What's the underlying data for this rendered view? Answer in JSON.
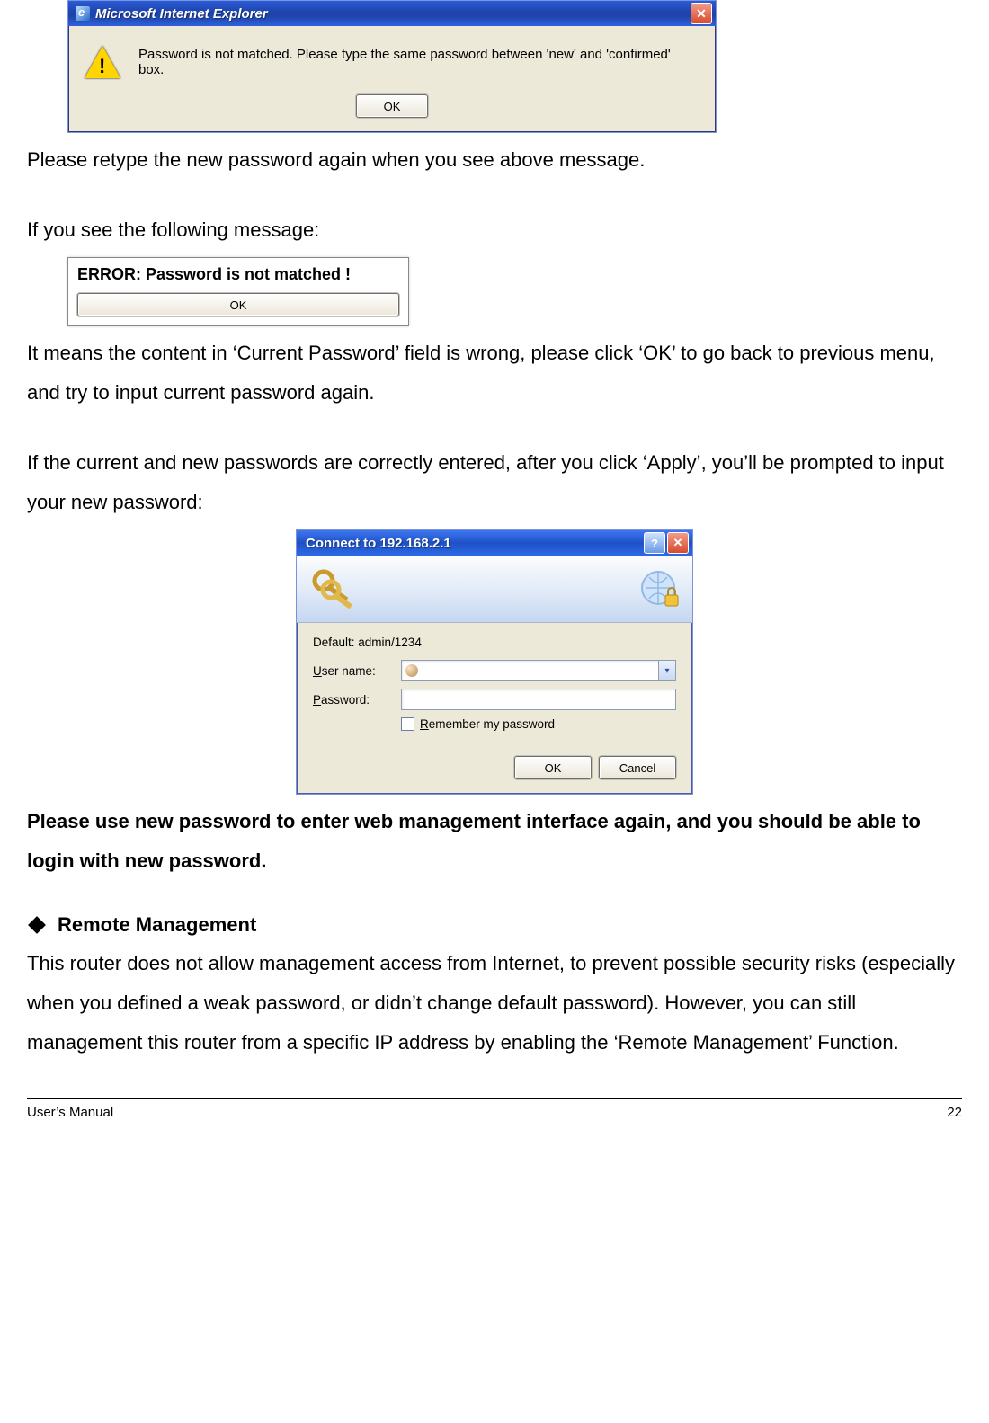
{
  "dialog1": {
    "title": "Microsoft Internet Explorer",
    "message": "Password is not matched. Please type the same password between 'new' and 'confirmed' box.",
    "ok": "OK"
  },
  "para1": "Please retype the new password again when you see above message.",
  "para2": "If you see the following message:",
  "dialog2": {
    "title": "ERROR: Password is not matched !",
    "ok": "OK"
  },
  "para3": "It means the content in ‘Current Password’ field is wrong, please click ‘OK’ to go back to previous menu, and try to input current password again.",
  "para4": "If the current and new passwords are correctly entered, after you click ‘Apply’, you’ll be prompted to input your new password:",
  "dialog3": {
    "title": "Connect to 192.168.2.1",
    "default": "Default: admin/1234",
    "user_label": "User name:",
    "pass_label": "Password:",
    "remember": "Remember my password",
    "ok": "OK",
    "cancel": "Cancel"
  },
  "para5": "Please use new password to enter web management interface again, and you should be able to login with new password.",
  "section": "Remote Management",
  "para6": "This router does not allow management access from Internet, to prevent possible security risks (especially when you defined a weak password, or didn’t change default password). However, you can still management this router from a specific IP address by enabling the ‘Remote Management’ Function.",
  "footer_left": "User’s Manual",
  "footer_right": "22"
}
